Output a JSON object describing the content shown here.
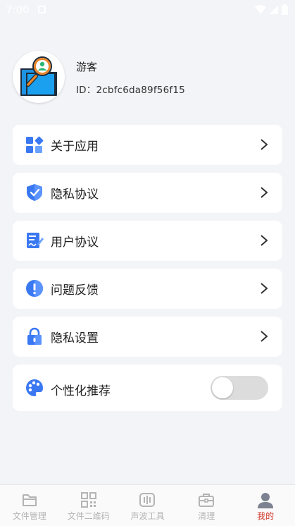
{
  "status_bar": {
    "time": "7:00"
  },
  "profile": {
    "username": "游客",
    "user_id": "ID：2cbfc6da89f56f15"
  },
  "menu": {
    "items": [
      {
        "label": "关于应用",
        "icon": "app-grid-icon"
      },
      {
        "label": "隐私协议",
        "icon": "shield-check-icon"
      },
      {
        "label": "用户协议",
        "icon": "document-sign-icon"
      },
      {
        "label": "问题反馈",
        "icon": "exclamation-circle-icon"
      },
      {
        "label": "隐私设置",
        "icon": "padlock-icon"
      }
    ],
    "toggle_item": {
      "label": "个性化推荐",
      "icon": "palette-icon",
      "enabled": false
    }
  },
  "bottom_nav": {
    "items": [
      {
        "label": "文件管理",
        "icon": "folder-icon",
        "active": false
      },
      {
        "label": "文件二维码",
        "icon": "qr-code-icon",
        "active": false
      },
      {
        "label": "声波工具",
        "icon": "soundwave-icon",
        "active": false
      },
      {
        "label": "清理",
        "icon": "toolbox-icon",
        "active": false
      },
      {
        "label": "我的",
        "icon": "user-icon",
        "active": true
      }
    ]
  },
  "colors": {
    "accent": "#d33a2c",
    "background": "#f3f4f8",
    "icon_blue": "#3a78f2"
  }
}
